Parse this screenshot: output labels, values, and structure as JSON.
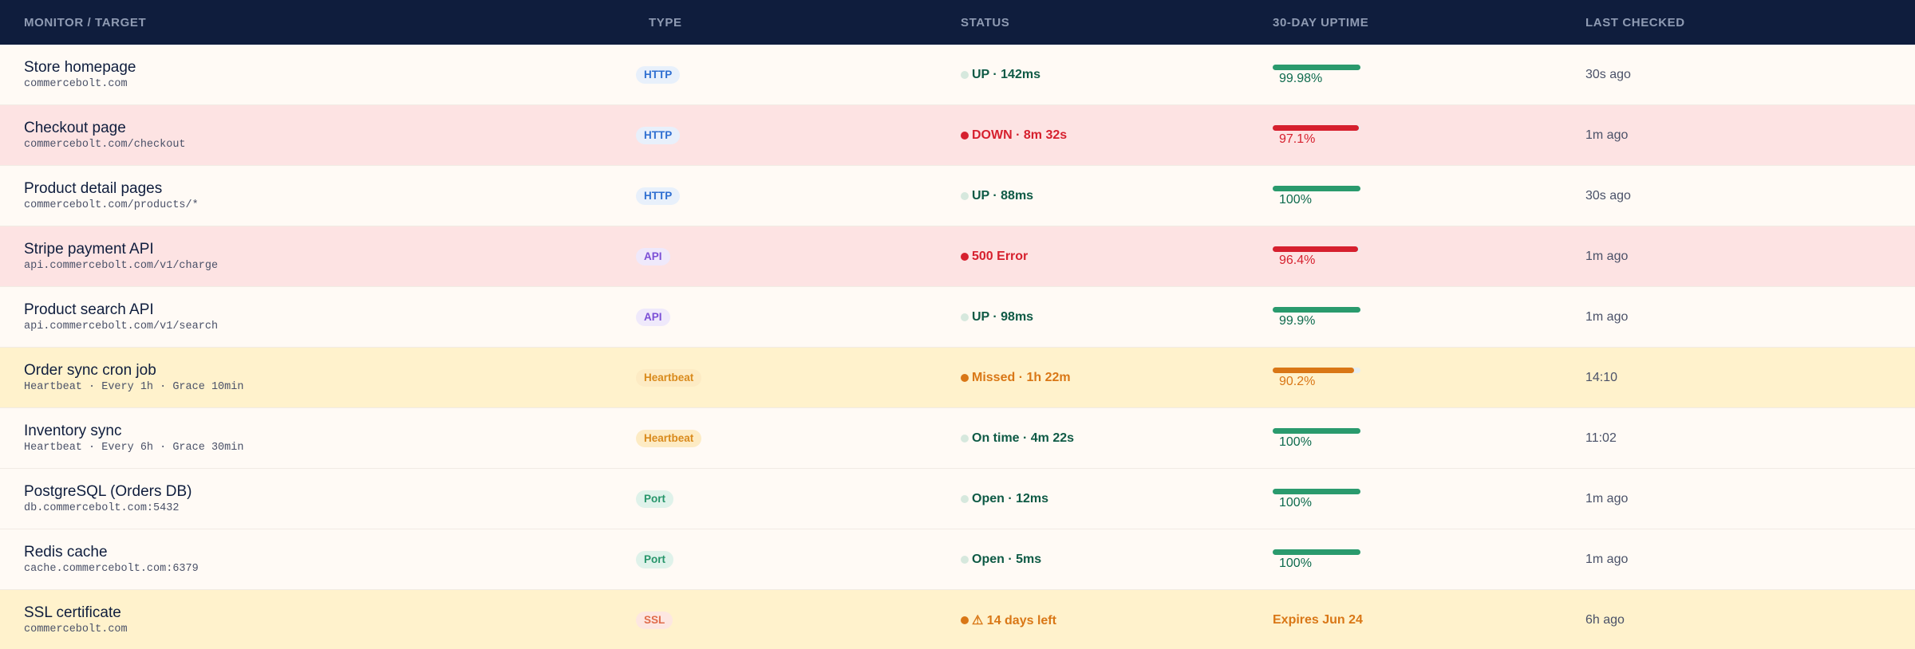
{
  "header": {
    "monitor": "MONITOR / TARGET",
    "type": "TYPE",
    "status": "STATUS",
    "uptime": "30-DAY UPTIME",
    "last_checked": "LAST CHECKED"
  },
  "colors": {
    "header_bg": "#0f1d3d",
    "ok": "#2a9a6d",
    "down": "#d6202e",
    "warning": "#d97716"
  },
  "rows": [
    {
      "name": "Store homepage",
      "target": "commercebolt.com",
      "type": "HTTP",
      "type_key": "http",
      "status": "UP · 142ms",
      "state": "ok",
      "row": "normal",
      "uptime": "99.98%",
      "uptime_fraction": 0.9998,
      "last_checked": "30s ago"
    },
    {
      "name": "Checkout page",
      "target": "commercebolt.com/checkout",
      "type": "HTTP",
      "type_key": "http",
      "status": "DOWN · 8m 32s",
      "state": "down",
      "row": "down",
      "uptime": "97.1%",
      "uptime_fraction": 0.971,
      "last_checked": "1m ago"
    },
    {
      "name": "Product detail pages",
      "target": "commercebolt.com/products/*",
      "type": "HTTP",
      "type_key": "http",
      "status": "UP · 88ms",
      "state": "ok",
      "row": "normal",
      "uptime": "100%",
      "uptime_fraction": 1.0,
      "last_checked": "30s ago"
    },
    {
      "name": "Stripe payment API",
      "target": "api.commercebolt.com/v1/charge",
      "type": "API",
      "type_key": "api",
      "status": "500 Error",
      "state": "down",
      "row": "down",
      "uptime": "96.4%",
      "uptime_fraction": 0.964,
      "last_checked": "1m ago"
    },
    {
      "name": "Product search API",
      "target": "api.commercebolt.com/v1/search",
      "type": "API",
      "type_key": "api",
      "status": "UP · 98ms",
      "state": "ok",
      "row": "normal",
      "uptime": "99.9%",
      "uptime_fraction": 0.999,
      "last_checked": "1m ago"
    },
    {
      "name": "Order sync cron job",
      "target": "Heartbeat · Every 1h · Grace 10min",
      "type": "Heartbeat",
      "type_key": "heartbeat",
      "status": "Missed · 1h 22m",
      "state": "warn",
      "row": "warning",
      "uptime": "90.2%",
      "uptime_fraction": 0.902,
      "last_checked": "14:10"
    },
    {
      "name": "Inventory sync",
      "target": "Heartbeat · Every 6h · Grace 30min",
      "type": "Heartbeat",
      "type_key": "heartbeat",
      "status": "On time · 4m 22s",
      "state": "ok",
      "row": "normal",
      "uptime": "100%",
      "uptime_fraction": 1.0,
      "last_checked": "11:02"
    },
    {
      "name": "PostgreSQL (Orders DB)",
      "target": "db.commercebolt.com:5432",
      "type": "Port",
      "type_key": "port",
      "status": "Open · 12ms",
      "state": "ok",
      "row": "normal",
      "uptime": "100%",
      "uptime_fraction": 1.0,
      "last_checked": "1m ago"
    },
    {
      "name": "Redis cache",
      "target": "cache.commercebolt.com:6379",
      "type": "Port",
      "type_key": "port",
      "status": "Open · 5ms",
      "state": "ok",
      "row": "normal",
      "uptime": "100%",
      "uptime_fraction": 1.0,
      "last_checked": "1m ago"
    },
    {
      "name": "SSL certificate",
      "target": "commercebolt.com",
      "type": "SSL",
      "type_key": "ssl",
      "status": "⚠ 14 days left",
      "state": "warn",
      "row": "warning",
      "uptime": "Expires Jun 24",
      "uptime_fraction": null,
      "last_checked": "6h ago"
    }
  ]
}
